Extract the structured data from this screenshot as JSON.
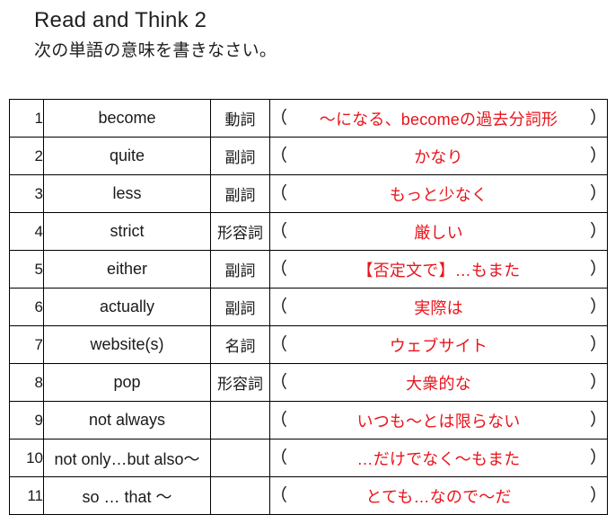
{
  "header": {
    "title": "Read and Think 2",
    "instruction": "次の単語の意味を書きなさい。"
  },
  "colors": {
    "answer_red": "#e8141c",
    "text_black": "#1a1a1a",
    "border": "#000000"
  },
  "table": {
    "paren_open": "（",
    "paren_close": "）",
    "rows": [
      {
        "num": "1",
        "word": "become",
        "pos": "動詞",
        "answer": "～になる、becomeの過去分詞形"
      },
      {
        "num": "2",
        "word": "quite",
        "pos": "副詞",
        "answer": "かなり"
      },
      {
        "num": "3",
        "word": "less",
        "pos": "副詞",
        "answer": "もっと少なく"
      },
      {
        "num": "4",
        "word": "strict",
        "pos": "形容詞",
        "answer": "厳しい"
      },
      {
        "num": "5",
        "word": "either",
        "pos": "副詞",
        "answer": "【否定文で】…もまた"
      },
      {
        "num": "6",
        "word": "actually",
        "pos": "副詞",
        "answer": "実際は"
      },
      {
        "num": "7",
        "word": "website(s)",
        "pos": "名詞",
        "answer": "ウェブサイト"
      },
      {
        "num": "8",
        "word": "pop",
        "pos": "形容詞",
        "answer": "大衆的な"
      },
      {
        "num": "9",
        "word": "not always",
        "pos": "",
        "answer": "いつも～とは限らない"
      },
      {
        "num": "10",
        "word": "not only…but also～",
        "pos": "",
        "answer": "…だけでなく～もまた"
      },
      {
        "num": "11",
        "word": "so … that ～",
        "pos": "",
        "answer": "とても…なので～だ"
      }
    ]
  }
}
